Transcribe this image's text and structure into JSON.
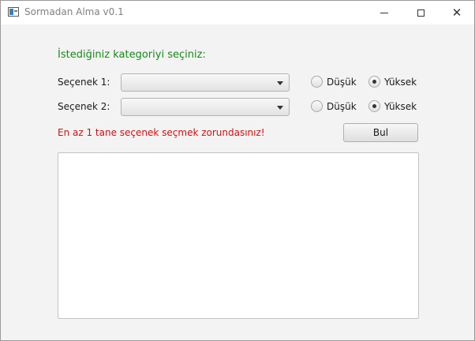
{
  "window": {
    "title": "Sormadan Alma v0.1",
    "icons": {
      "app": "app-window-icon",
      "minimize": "minimize-icon",
      "maximize": "maximize-icon",
      "close": "close-icon"
    }
  },
  "form": {
    "heading": "İstediğiniz kategoriyi seçiniz:",
    "option1": {
      "label": "Seçenek 1:",
      "value": "",
      "low_label": "Düşük",
      "high_label": "Yüksek",
      "selected": "Yüksek"
    },
    "option2": {
      "label": "Seçenek 2:",
      "value": "",
      "low_label": "Düşük",
      "high_label": "Yüksek",
      "selected": "Yüksek"
    },
    "error": "En az 1 tane seçenek seçmek zorundasınız!",
    "search_button": "Bul",
    "result_text": ""
  },
  "colors": {
    "heading": "#168a16",
    "error": "#d01010"
  }
}
